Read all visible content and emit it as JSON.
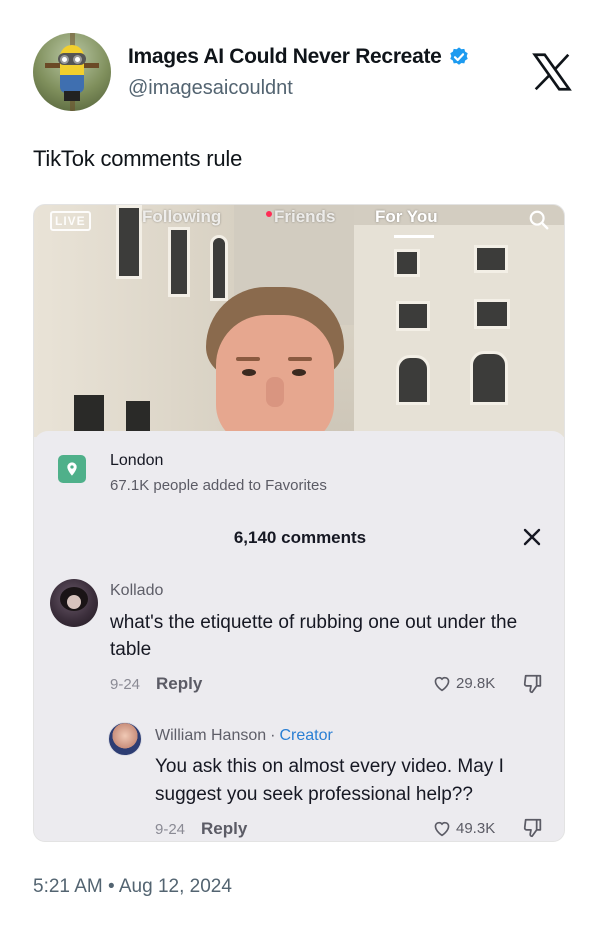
{
  "tweet": {
    "display_name": "Images AI Could Never Recreate",
    "handle": "@imagesaicouldnt",
    "text": "TikTok comments rule",
    "timestamp": "5:21 AM • Aug 12, 2024",
    "verified_color": "#1d9bf0"
  },
  "tiktok": {
    "nav": {
      "live_label": "LIVE",
      "tabs": [
        "Following",
        "Friends",
        "For You"
      ],
      "active_tab": "For You"
    },
    "location": {
      "title": "London",
      "subtitle": "67.1K people added to Favorites"
    },
    "comment_count": "6,140 comments",
    "comments": [
      {
        "author": "Kollado",
        "text": "what's the etiquette of rubbing one out under the table",
        "date": "9-24",
        "reply_label": "Reply",
        "likes": "29.8K"
      },
      {
        "author": "William Hanson",
        "separator": "·",
        "badge": "Creator",
        "text": "You ask this on almost every video. May I suggest you seek professional help??",
        "date": "9-24",
        "reply_label": "Reply",
        "likes": "49.3K"
      }
    ],
    "accent_colors": {
      "location": "#4fb08a",
      "creator": "#2a7fd4",
      "notification": "#fe2c55"
    }
  }
}
